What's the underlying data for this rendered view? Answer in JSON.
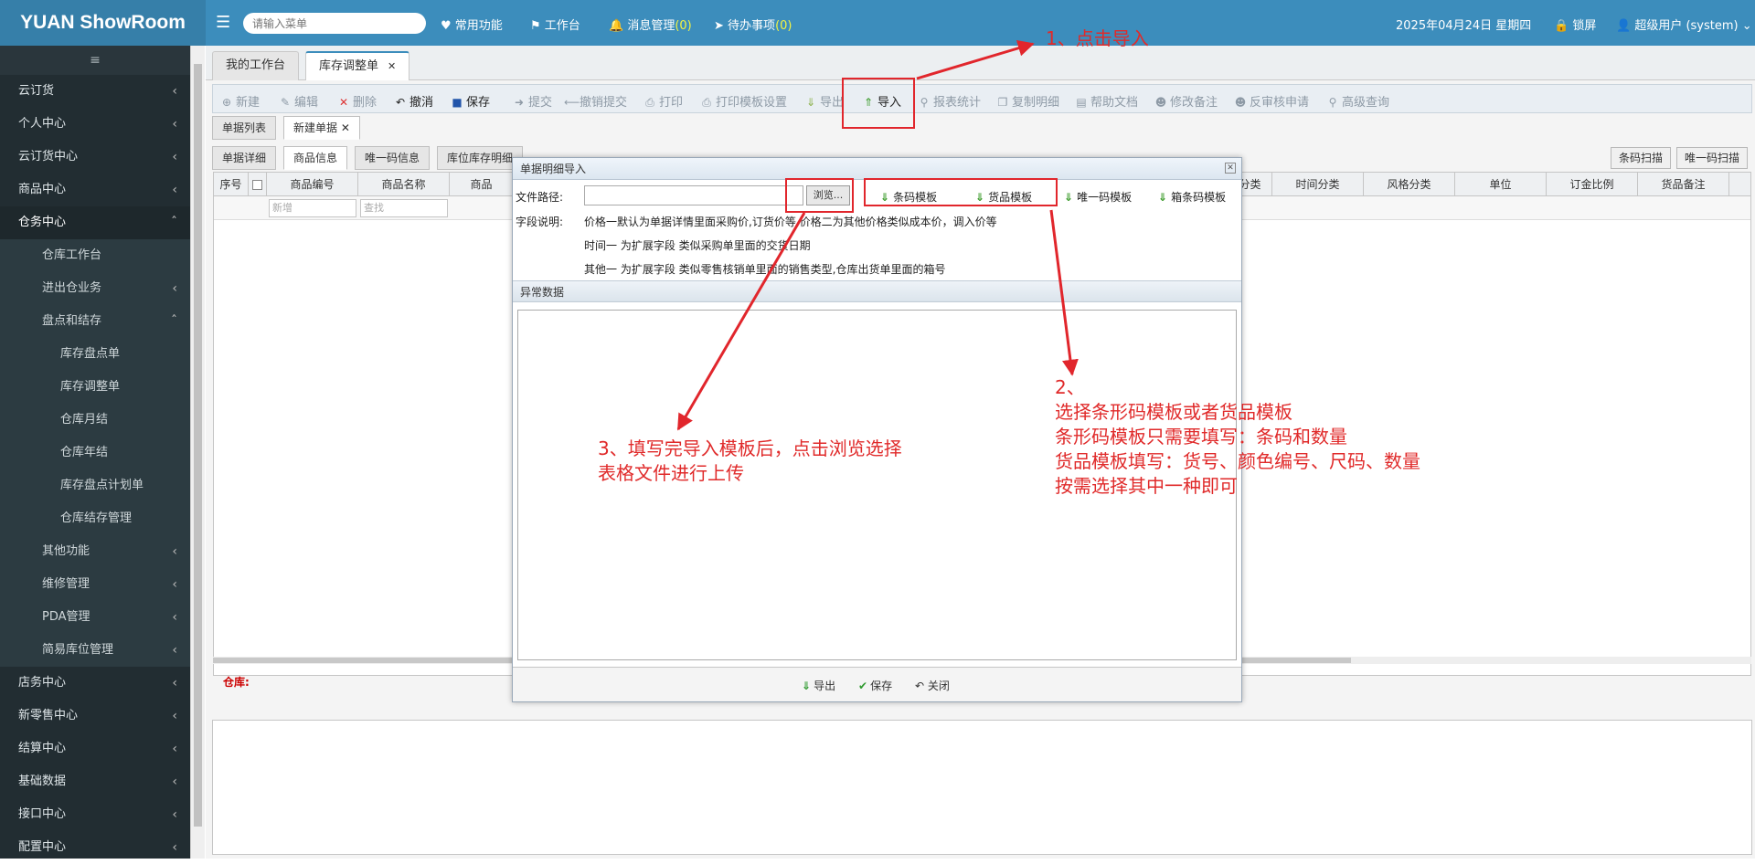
{
  "header": {
    "brand": "YUAN ShowRoom",
    "search_placeholder": "请输入菜单",
    "nav": {
      "common": "常用功能",
      "workbench": "工作台",
      "messages": "消息管理",
      "messages_count": "(0)",
      "todo": "待办事项",
      "todo_count": "(0)"
    },
    "date": "2025年04月24日 星期四",
    "lock": "锁屏",
    "user": "超级用户 (system)"
  },
  "sidebar": {
    "items": [
      {
        "label": "云订货"
      },
      {
        "label": "个人中心"
      },
      {
        "label": "云订货中心"
      },
      {
        "label": "商品中心"
      },
      {
        "label": "仓务中心"
      },
      {
        "label": "仓库工作台"
      },
      {
        "label": "进出仓业务"
      },
      {
        "label": "盘点和结存"
      },
      {
        "label": "库存盘点单"
      },
      {
        "label": "库存调整单"
      },
      {
        "label": "仓库月结"
      },
      {
        "label": "仓库年结"
      },
      {
        "label": "库存盘点计划单"
      },
      {
        "label": "仓库结存管理"
      },
      {
        "label": "其他功能"
      },
      {
        "label": "维修管理"
      },
      {
        "label": "PDA管理"
      },
      {
        "label": "简易库位管理"
      },
      {
        "label": "店务中心"
      },
      {
        "label": "新零售中心"
      },
      {
        "label": "结算中心"
      },
      {
        "label": "基础数据"
      },
      {
        "label": "接口中心"
      },
      {
        "label": "配置中心"
      }
    ]
  },
  "page_tabs": [
    {
      "label": "我的工作台"
    },
    {
      "label": "库存调整单"
    }
  ],
  "toolbar": {
    "new": "新建",
    "edit": "编辑",
    "delete": "删除",
    "cancel": "撤消",
    "save": "保存",
    "submit": "提交",
    "revoke": "撤销提交",
    "print": "打印",
    "print_tpl": "打印模板设置",
    "export": "导出",
    "import": "导入",
    "report": "报表统计",
    "copy": "复制明细",
    "help": "帮助文档",
    "remark": "修改备注",
    "reverse": "反审核申请",
    "query": "高级查询"
  },
  "doc_tabs": [
    {
      "label": "单据列表"
    },
    {
      "label": "新建单据"
    }
  ],
  "detail_tabs": [
    {
      "label": "单据详细"
    },
    {
      "label": "商品信息"
    },
    {
      "label": "唯一码信息"
    },
    {
      "label": "库位库存明细"
    }
  ],
  "right_buttons": {
    "barcode_scan": "条码扫描",
    "unique_scan": "唯一码扫描"
  },
  "grid": {
    "columns_left": [
      "序号",
      "商品编号",
      "商品名称",
      "商品"
    ],
    "columns_right": [
      "分类",
      "时间分类",
      "风格分类",
      "单位",
      "订金比例",
      "货品备注"
    ],
    "filter_new": "新增",
    "filter_search": "查找"
  },
  "warehouse_label": "仓库:",
  "dialog": {
    "title": "单据明细导入",
    "file_path_label": "文件路径:",
    "browse": "浏览...",
    "templates": {
      "barcode": "条码模板",
      "goods": "货品模板",
      "unique": "唯一码模板",
      "box": "箱条码模板"
    },
    "field_desc_label": "字段说明:",
    "field_desc": [
      "价格一默认为单据详情里面采购价,订货价等 价格二为其他价格类似成本价，调入价等",
      "时间一 为扩展字段 类似采购单里面的交货日期",
      "其他一 为扩展字段 类似零售核销单里面的销售类型,仓库出货单里面的箱号"
    ],
    "abnormal_label": "异常数据",
    "footer": {
      "export": "导出",
      "save": "保存",
      "close": "关闭"
    }
  },
  "annotations": {
    "step1": "1、点击导入",
    "step2": [
      "2、",
      "选择条形码模板或者货品模板",
      "条形码模板只需要填写：条码和数量",
      "货品模板填写：货号、颜色编号、尺码、数量",
      "按需选择其中一种即可"
    ],
    "step3": [
      "3、填写完导入模板后，点击浏览选择",
      "表格文件进行上传"
    ],
    "color": "#e02a2a"
  }
}
